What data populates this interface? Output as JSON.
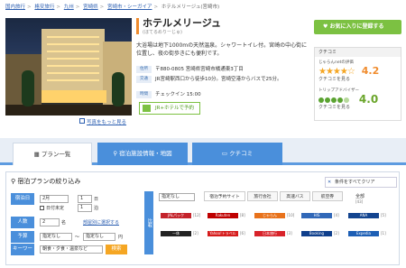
{
  "breadcrumb": [
    "国内旅行",
    "格安旅行",
    "九州",
    "宮崎県",
    "宮崎市・シーガイア",
    "ホテルメリージュ(宮崎市)"
  ],
  "hotel": {
    "name": "ホテルメリージュ",
    "kana": "(ほてるめりーじゅ)",
    "description": "大浴場は地下1000mの天然温泉。シャワートイレ付。宮崎の中心街に位置し、夜の街歩きにも便利です。",
    "address_label": "住所",
    "address": "〒880-0805 宮崎県宮崎市橘通東3丁目",
    "access_label": "交通",
    "access": "JR宮崎駅西口から徒歩10分。宮崎空港からバスで25分。",
    "checkin_label": "時間",
    "checkin": "チェックイン 15:00",
    "plan_button": "JR+ホテルで予約",
    "photo_link": "写真をもっと見る"
  },
  "favorite_button": "お気に入りに登録する",
  "review": {
    "header": "クチコミ",
    "source1": "じゃらんnetの評価",
    "score1": "4.2",
    "stars1": "★★★★☆",
    "kuchikomi1": "クチコミを見る",
    "source2": "トリップアドバイザー",
    "score2": "4.0",
    "kuchikomi2": "クチコミを見る"
  },
  "tabs": [
    "プラン一覧",
    "宿泊施設情報・地図",
    "クチコミ"
  ],
  "search": {
    "title": "宿泊プランの絞り込み",
    "clear": "条件をすべてクリア",
    "row_labels": [
      "宿泊日",
      "人数",
      "予算",
      "キーワード"
    ],
    "date_select": "2月",
    "day_select": "1",
    "day_suffix": "日",
    "nights_check": "日付未定",
    "nights_select": "1",
    "nights_suffix": "泊",
    "rooms_select": "2",
    "rooms_suffix": "名",
    "room_link": "部屋別に選択する",
    "budget_from": "指定なし",
    "budget_to": "指定なし",
    "budget_suffix": "円",
    "keyword_placeholder": "朝食・夕食・温泉など",
    "search_button": "検索",
    "sites_label": "比較",
    "sort_select": "指定なし",
    "site_tabs": [
      "宿泊予約サイト",
      "旅行会社",
      "高速バス",
      "航空券"
    ],
    "site_all": "全部",
    "site_count": "[43]"
  },
  "sites": [
    {
      "name": "JALパック",
      "color": "#c4232b",
      "count": "[12]"
    },
    {
      "name": "Rakuten",
      "color": "#bf0000",
      "count": "[8]"
    },
    {
      "name": "じゃらん",
      "color": "#e8721b",
      "count": "[10]"
    },
    {
      "name": "HIS",
      "color": "#3168b8",
      "count": "[4]"
    },
    {
      "name": "ANA",
      "color": "#13448f",
      "count": "[5]"
    },
    {
      "name": "一休",
      "color": "#222222",
      "count": "[2]"
    },
    {
      "name": "Yahoo!トラベル",
      "color": "#d61c1c",
      "count": "[6]"
    },
    {
      "name": "日本旅行",
      "color": "#d8232a",
      "count": "[3]"
    },
    {
      "name": "Booking",
      "color": "#0f3f8c",
      "count": "[2]"
    },
    {
      "name": "Expedia",
      "color": "#1d5fb5",
      "count": "[1]"
    }
  ]
}
